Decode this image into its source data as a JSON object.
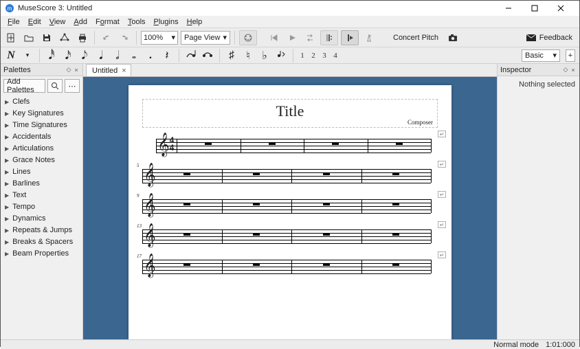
{
  "window": {
    "title": "MuseScore 3: Untitled"
  },
  "menu": [
    "File",
    "Edit",
    "View",
    "Add",
    "Format",
    "Tools",
    "Plugins",
    "Help"
  ],
  "toolbar": {
    "zoom": "100%",
    "viewmode": "Page View",
    "concert_pitch": "Concert Pitch",
    "feedback": "Feedback"
  },
  "notebar": {
    "voices": [
      "1",
      "2",
      "3",
      "4"
    ],
    "workspace": "Basic"
  },
  "palettes": {
    "title": "Palettes",
    "add_btn": "Add Palettes",
    "items": [
      "Clefs",
      "Key Signatures",
      "Time Signatures",
      "Accidentals",
      "Articulations",
      "Grace Notes",
      "Lines",
      "Barlines",
      "Text",
      "Tempo",
      "Dynamics",
      "Repeats & Jumps",
      "Breaks & Spacers",
      "Beam Properties"
    ]
  },
  "tabs": [
    {
      "label": "Untitled"
    }
  ],
  "score": {
    "title": "Title",
    "composer": "Composer",
    "timesig": {
      "top": "4",
      "bottom": "4"
    },
    "systems": [
      {
        "num": "",
        "first": true
      },
      {
        "num": "5",
        "first": false
      },
      {
        "num": "9",
        "first": false
      },
      {
        "num": "13",
        "first": false
      },
      {
        "num": "17",
        "first": false
      }
    ]
  },
  "inspector": {
    "title": "Inspector",
    "message": "Nothing selected"
  },
  "status": {
    "mode": "Normal mode",
    "pos": "1:01:000"
  }
}
